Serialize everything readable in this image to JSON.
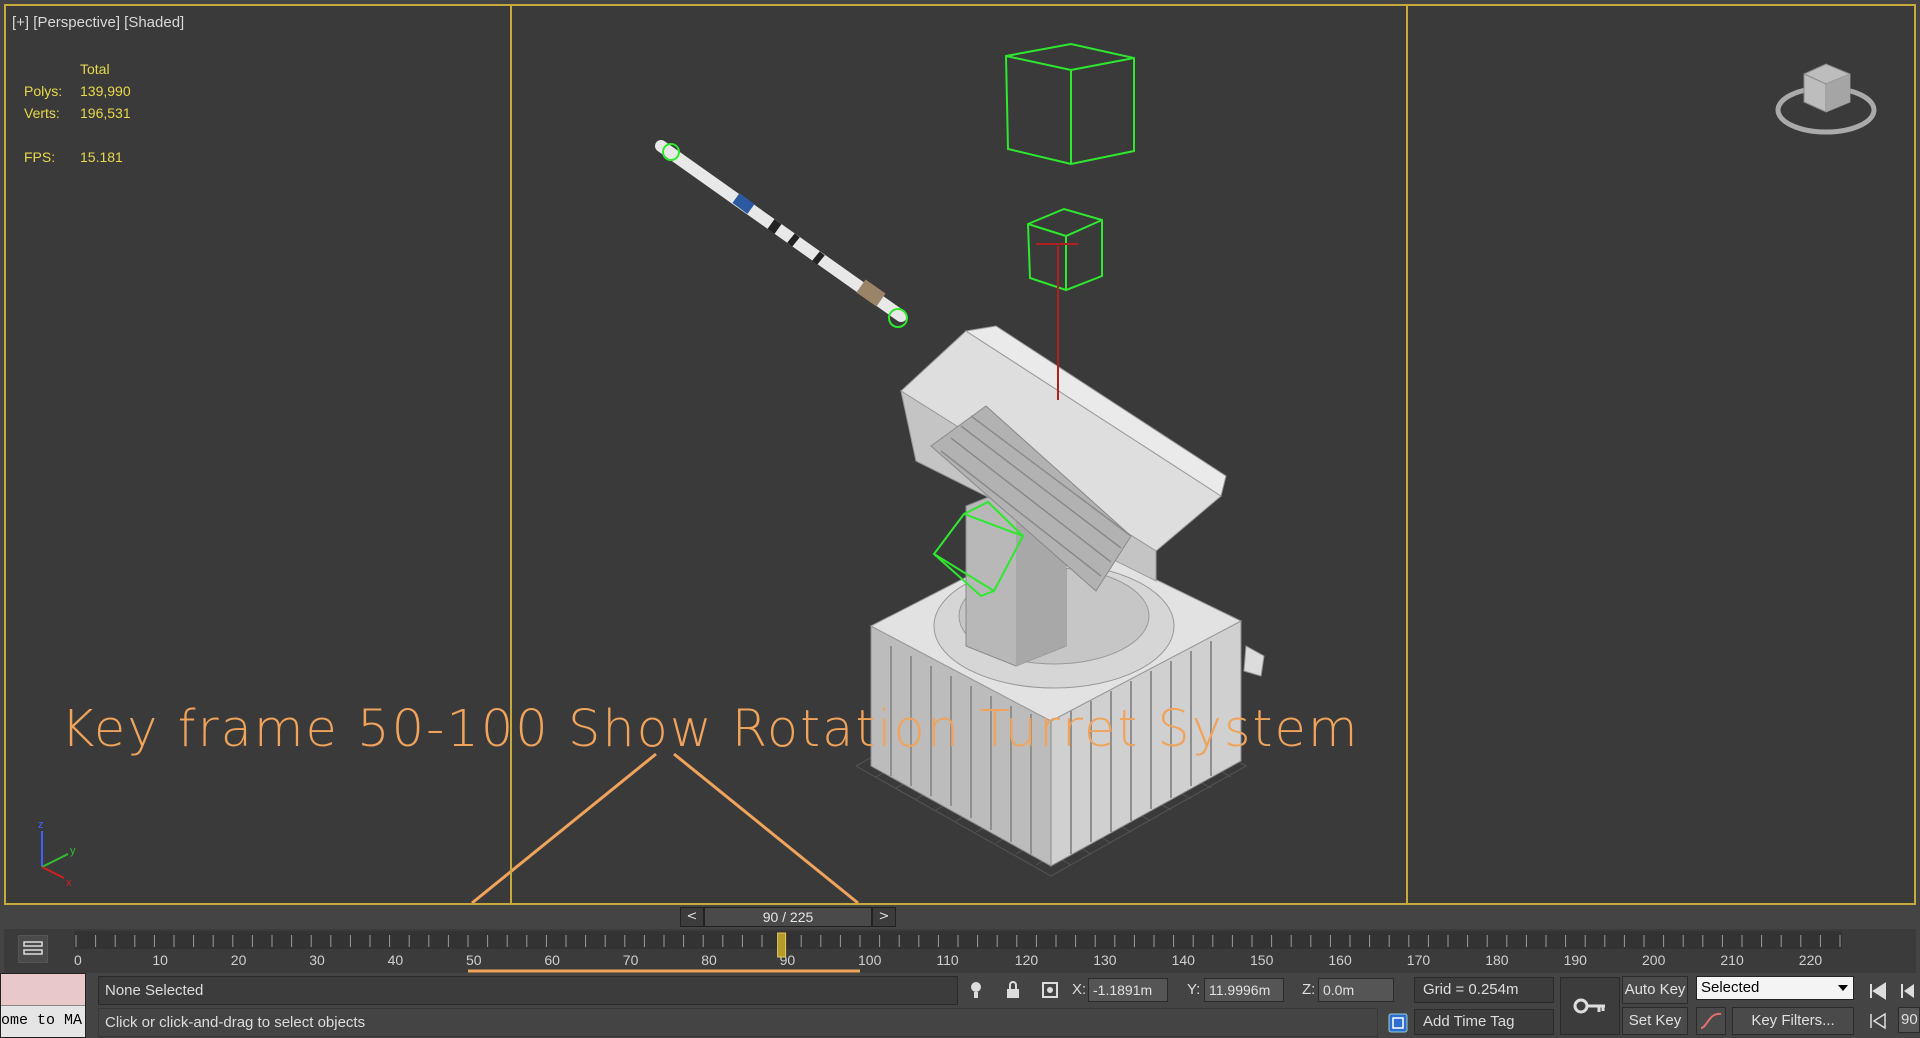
{
  "viewport": {
    "label_plus": "[+]",
    "label_view": "[Perspective]",
    "label_shading": "[Shaded]",
    "stats": {
      "header": "Total",
      "polys_label": "Polys:",
      "polys_value": "139,990",
      "verts_label": "Verts:",
      "verts_value": "196,531",
      "fps_label": "FPS:",
      "fps_value": "15.181"
    },
    "annotation": "Key frame 50-100 Show Rotation Turret System",
    "axis_labels": {
      "x": "x",
      "y": "y",
      "z": "z"
    }
  },
  "time_slider": {
    "prev": "<",
    "next": ">",
    "position": "90 / 225",
    "current_frame": 90,
    "total_frames": 225
  },
  "trackbar": {
    "ticks": [
      "0",
      "10",
      "20",
      "30",
      "40",
      "50",
      "60",
      "70",
      "80",
      "90",
      "100",
      "110",
      "120",
      "130",
      "140",
      "150",
      "160",
      "170",
      "180",
      "190",
      "200",
      "210",
      "220"
    ],
    "highlight_range": [
      50,
      100
    ]
  },
  "status": {
    "maxscript_text": "ome to MA",
    "selection": "None Selected",
    "prompt": "Click or click-and-drag to select objects",
    "x_label": "X:",
    "x_value": "-1.1891m",
    "y_label": "Y:",
    "y_value": "11.9996m",
    "z_label": "Z:",
    "z_value": "0.0m",
    "grid": "Grid = 0.254m",
    "add_time_tag": "Add Time Tag",
    "auto_key": "Auto Key",
    "set_key": "Set Key",
    "selected_option": "Selected",
    "key_filters": "Key Filters...",
    "frame_value": "90"
  },
  "colors": {
    "viewport_border": "#c9a93b",
    "stats_text": "#e8d84a",
    "annotation": "#f0a35b",
    "helper_green": "#2ee82e"
  }
}
